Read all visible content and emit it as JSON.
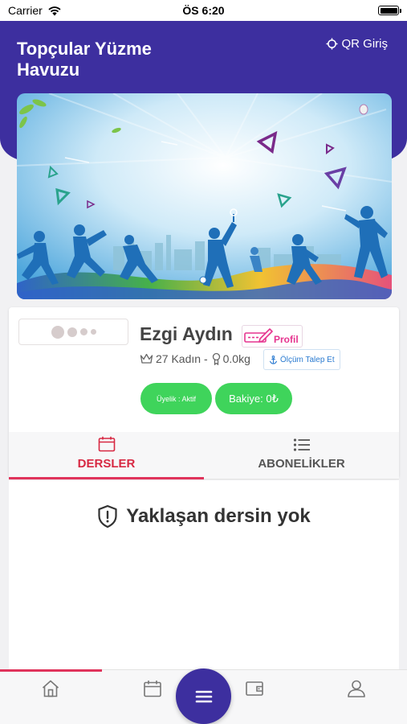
{
  "status_bar": {
    "carrier": "Carrier",
    "time": "ÖS 6:20",
    "battery_level": 1.0
  },
  "header": {
    "title": "Topçular Yüzme Havuzu",
    "qr_login_label": "QR Giriş"
  },
  "profile": {
    "name": "Ezgi Aydın",
    "profile_link_label": "Profil",
    "age_gender": "27 Kadın -",
    "weight": "0.0kg",
    "measurement_request_label": "Ölçüm Talep Et",
    "membership_badge": "Üyelik : Aktif",
    "balance_badge": "Bakiye: 0₺"
  },
  "tabs": [
    {
      "label": "DERSLER",
      "icon": "calendar-icon",
      "active": true
    },
    {
      "label": "ABONELİKLER",
      "icon": "list-icon",
      "active": false
    }
  ],
  "content": {
    "empty_message": "Yaklaşan dersin yok"
  },
  "bottom_nav": {
    "items": [
      "home-icon",
      "calendar-icon",
      "wallet-icon",
      "user-icon"
    ],
    "fab_icon": "menu-icon",
    "active_index": 0
  },
  "colors": {
    "brand": "#3d2f9f",
    "accent": "#e0335b",
    "success": "#3fd45b",
    "profile_pink": "#e6348f",
    "link_blue": "#2b7bd1"
  }
}
